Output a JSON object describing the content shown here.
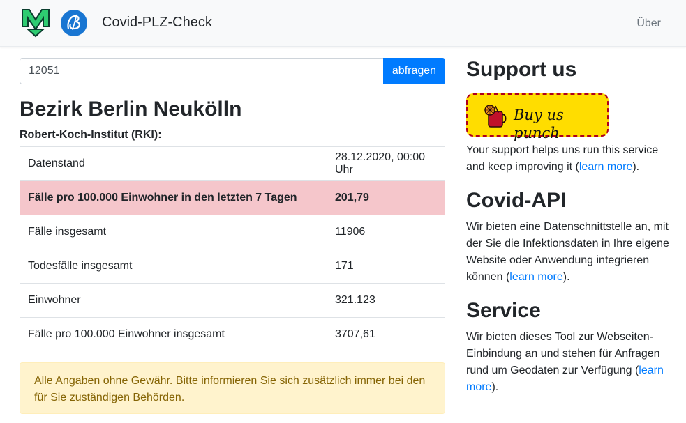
{
  "navbar": {
    "brand": "Covid-PLZ-Check",
    "about_link": "Über"
  },
  "search": {
    "value": "12051",
    "button_label": "abfragen"
  },
  "result": {
    "district": "Bezirk Berlin Neukölln",
    "source": "Robert-Koch-Institut (RKI):",
    "rows": [
      {
        "label": "Datenstand",
        "value": "28.12.2020, 00:00 Uhr"
      },
      {
        "label": "Fälle pro 100.000 Einwohner in den letzten 7 Tagen",
        "value": "201,79"
      },
      {
        "label": "Fälle insgesamt",
        "value": "11906"
      },
      {
        "label": "Todesfälle insgesamt",
        "value": "171"
      },
      {
        "label": "Einwohner",
        "value": "321.123"
      },
      {
        "label": "Fälle pro 100.000 Einwohner insgesamt",
        "value": "3707,61"
      }
    ],
    "disclaimer": "Alle Angaben ohne Gewähr. Bitte informieren Sie sich zusätzlich immer bei den für Sie zuständigen Behörden."
  },
  "sidebar": {
    "support": {
      "title": "Support us",
      "button_label": "Buy us punch",
      "text_before": "Your support helps uns run this service and keep improving it (",
      "link": "learn more",
      "text_after": ")."
    },
    "api": {
      "title": "Covid-API",
      "text_before": "Wir bieten eine Datenschnittstelle an, mit der Sie die Infektionsdaten in Ihre eigene Website oder Anwendung integrieren können (",
      "link": "learn more",
      "text_after": ")."
    },
    "service": {
      "title": "Service",
      "text_before": "Wir bieten dieses Tool zur Webseiten-Einbindung an und stehen für Anfragen rund um Geodaten zur Verfügung (",
      "link": "learn more",
      "text_after": ")."
    }
  },
  "colors": {
    "navbar_bg": "#f8f9fa",
    "primary": "#007bff",
    "danger_row": "#f5c6cb",
    "warning_bg": "#fff3cd",
    "warning_text": "#856404",
    "punch_bg": "#ffdd00",
    "logo_green": "#2ecc71",
    "logo_blue": "#1976d2"
  },
  "icons": {
    "logo_m": "m-logo-icon",
    "logo_b": "b-logo-icon",
    "punch": "punch-drink-icon"
  }
}
